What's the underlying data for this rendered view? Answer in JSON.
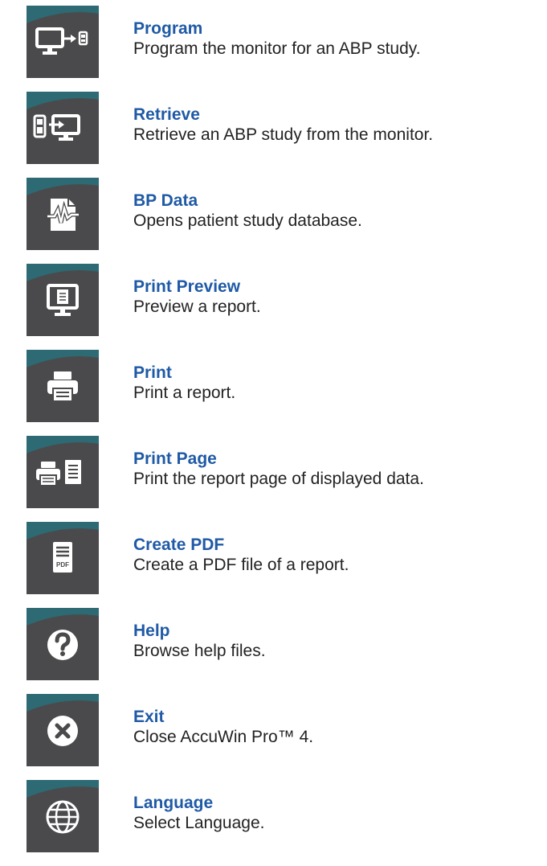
{
  "items": [
    {
      "title": "Program",
      "description": "Program the monitor for an ABP study.",
      "icon": "monitor-to-device-icon"
    },
    {
      "title": "Retrieve",
      "description": "Retrieve an ABP study from the monitor.",
      "icon": "device-to-monitor-icon"
    },
    {
      "title": "BP Data",
      "description": "Opens patient study database.",
      "icon": "waveform-document-icon"
    },
    {
      "title": "Print Preview",
      "description": "Preview a report.",
      "icon": "monitor-document-icon"
    },
    {
      "title": "Print",
      "description": "Print a report.",
      "icon": "printer-icon"
    },
    {
      "title": "Print Page",
      "description": "Print the report page of displayed data.",
      "icon": "printer-page-icon"
    },
    {
      "title": "Create PDF",
      "description": "Create a PDF file of a report.",
      "icon": "pdf-document-icon",
      "icon_text": "PDF"
    },
    {
      "title": "Help",
      "description": "Browse help files.",
      "icon": "question-icon"
    },
    {
      "title": "Exit",
      "description": "Close AccuWin Pro™ 4.",
      "icon": "close-circle-icon"
    },
    {
      "title": "Language",
      "description": "Select Language.",
      "icon": "globe-icon"
    }
  ],
  "colors": {
    "title": "#1f5aa6",
    "tile": "#4a4a4c",
    "wave": "#2d6a73",
    "glyph": "#ffffff"
  }
}
